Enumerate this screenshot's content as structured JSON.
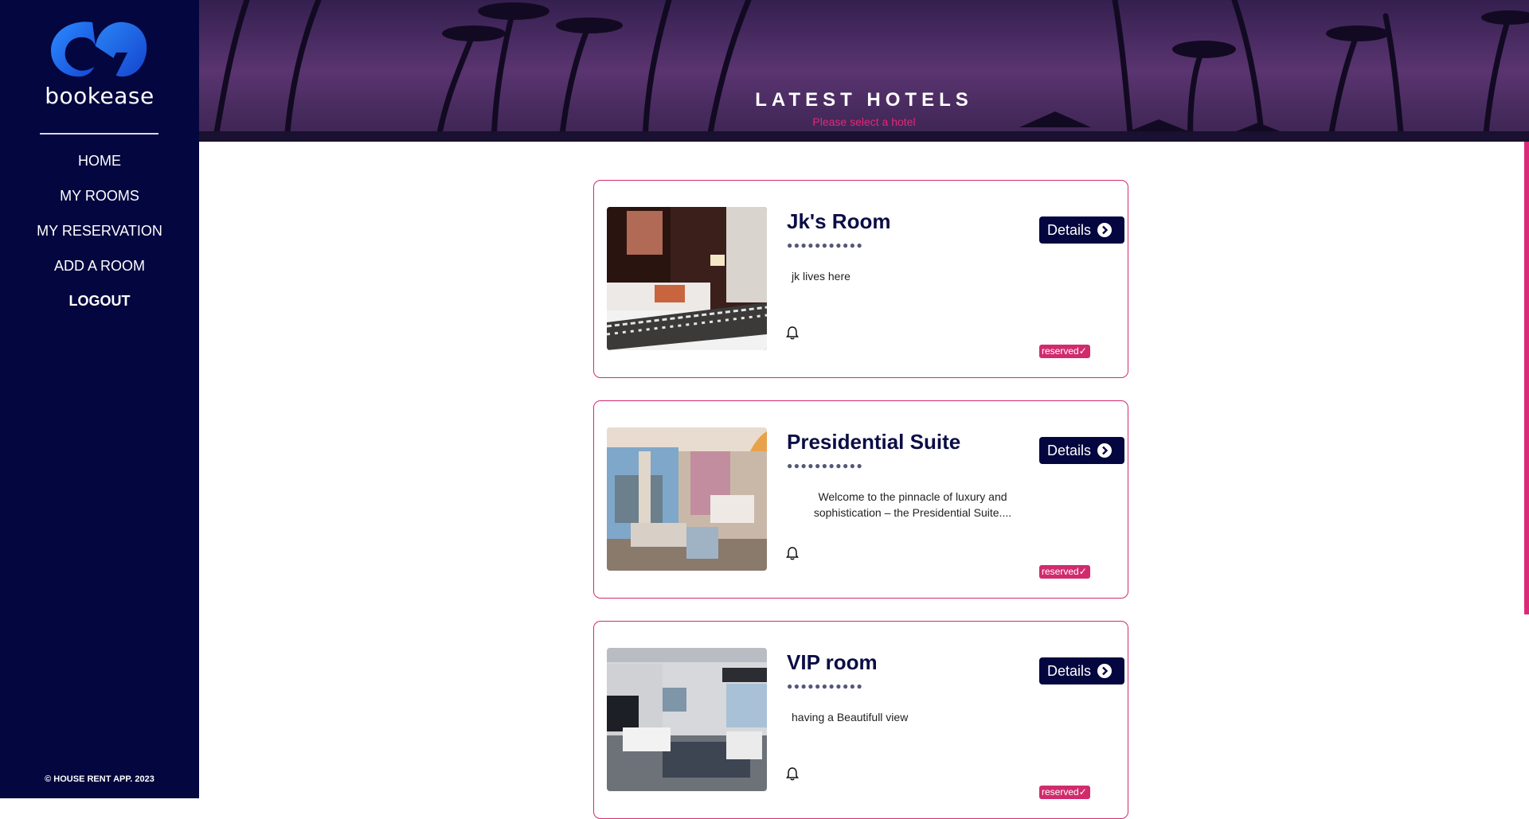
{
  "sidebar": {
    "brand": "bookease",
    "nav": [
      "HOME",
      "MY ROOMS",
      "MY RESERVATION",
      "ADD A ROOM",
      "LOGOUT"
    ],
    "copyright": "© HOUSE RENT APP. 2023"
  },
  "hero": {
    "title": "LATEST HOTELS",
    "subtitle": "Please select a hotel"
  },
  "cards": [
    {
      "title": "Jk's Room",
      "dots": "●●●●●●●●●●●",
      "description": "jk lives here",
      "details_label": "Details",
      "badge": "reserved✓"
    },
    {
      "title": "Presidential Suite",
      "dots": "●●●●●●●●●●●",
      "description": "Welcome to the pinnacle of luxury and sophistication – the Presidential Suite....",
      "details_label": "Details",
      "badge": "reserved✓"
    },
    {
      "title": "VIP room",
      "dots": "●●●●●●●●●●●",
      "description": "having a Beautifull view",
      "details_label": "Details",
      "badge": "reserved✓"
    }
  ],
  "colors": {
    "sidebar_bg": "#04063f",
    "accent": "#d12b6e",
    "logo_blue": "#1f6cf0",
    "button_bg": "#04063f"
  }
}
